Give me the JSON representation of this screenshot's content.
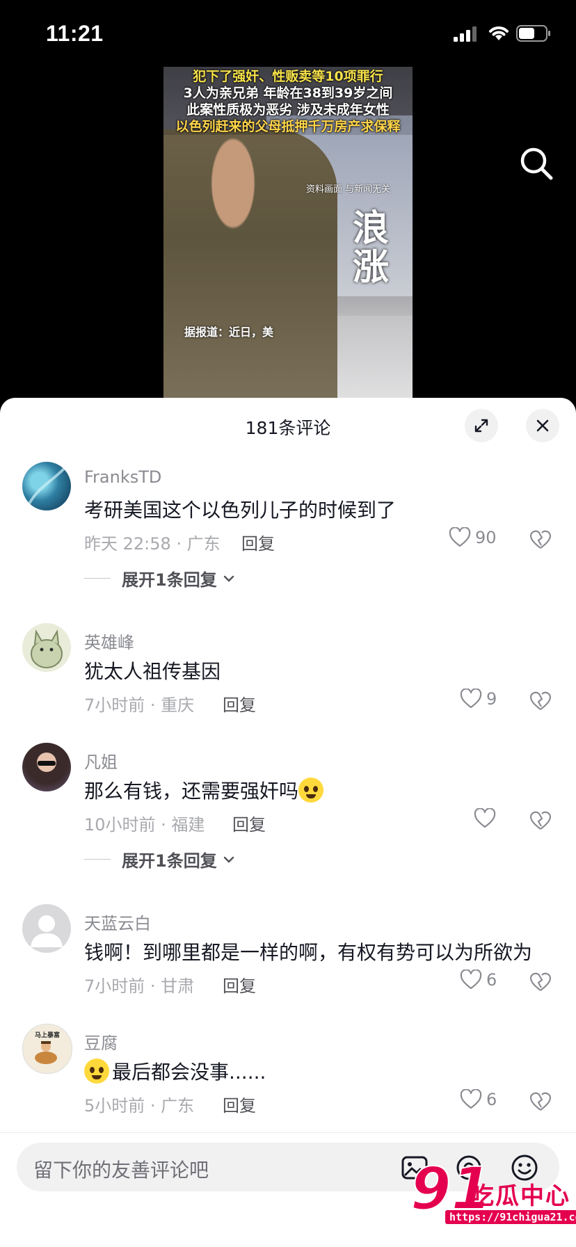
{
  "status_bar": {
    "time": "11:21"
  },
  "video": {
    "captions": [
      "犯下了强奸、性贩卖等10项罪行",
      "3人为亲兄弟 年龄在38到39岁之间",
      "此案性质极为恶劣 涉及未成年女性",
      "以色列赶来的父母抵押千万房产求保释"
    ],
    "note": "资料画面 与新闻无关",
    "watermark": "浪涨",
    "subtitle": "据报道：近日，美"
  },
  "sheet": {
    "title": "181条评论"
  },
  "comments": [
    {
      "user": "FranksTD",
      "text": "考研美国这个以色列儿子的时候到了",
      "meta": "昨天 22:58 · 广东",
      "reply": "回复",
      "likes": "90",
      "expand": "展开1条回复"
    },
    {
      "user": "英雄峰",
      "text": "犹太人祖传基因",
      "meta": "7小时前 · 重庆",
      "reply": "回复",
      "likes": "9"
    },
    {
      "user": "凡姐",
      "text": "那么有钱，还需要强奸吗",
      "meta": "10小时前 · 福建",
      "reply": "回复",
      "likes": "",
      "expand": "展开1条回复"
    },
    {
      "user": "天蓝云白",
      "text": "钱啊！到哪里都是一样的啊，有权有势可以为所欲为",
      "meta": "7小时前 · 甘肃",
      "reply": "回复",
      "likes": "6"
    },
    {
      "user": "豆腐",
      "text": "最后都会没事......",
      "meta": "5小时前 · 广东",
      "reply": "回复",
      "likes": "6",
      "avatar_text": "马上暴富"
    }
  ],
  "input": {
    "placeholder": "留下你的友善评论吧"
  },
  "watermark_overlay": {
    "num": "91",
    "cn": "吃瓜中心",
    "url": "https://91chigua21.com"
  },
  "colors": {
    "accent": "#e4004f",
    "text": "#161823",
    "muted": "#8a8b91"
  }
}
